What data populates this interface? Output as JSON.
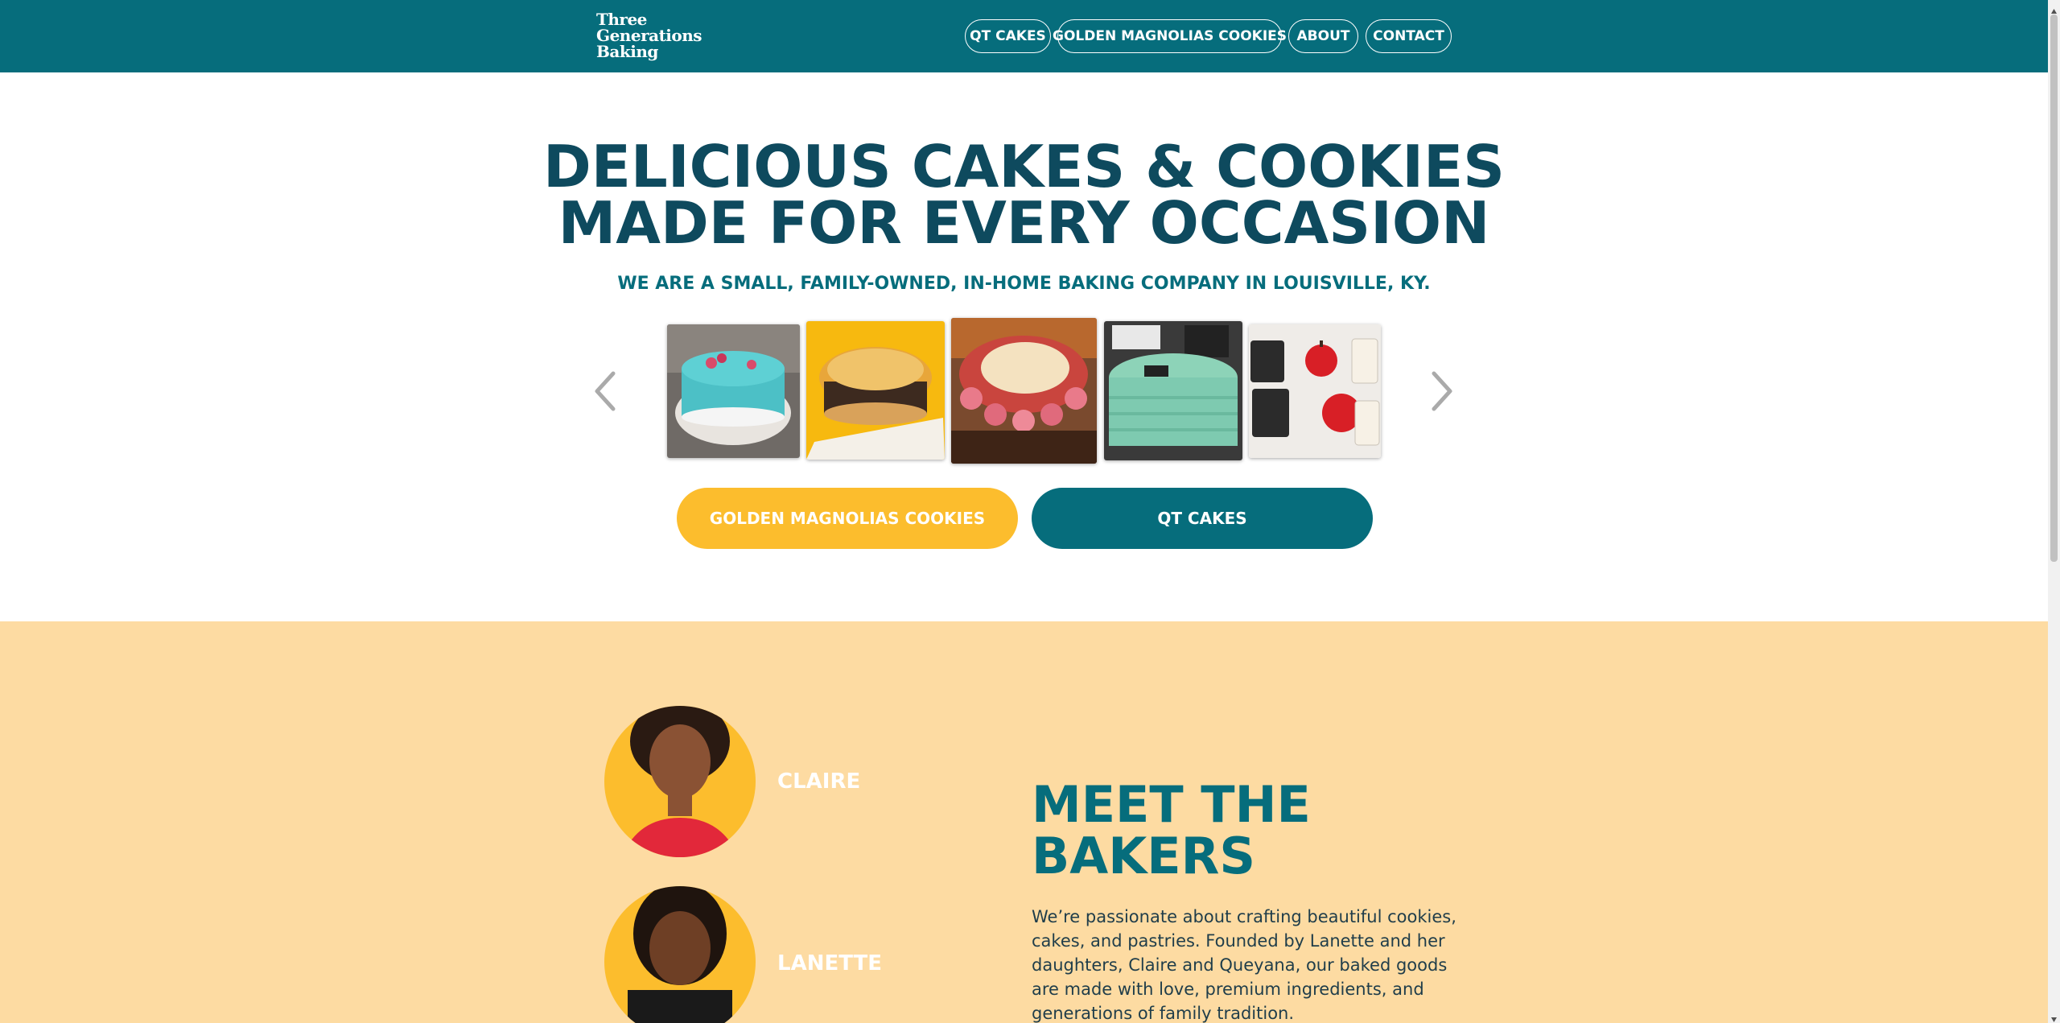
{
  "header": {
    "logo_lines": [
      "Three",
      "Generations",
      "Baking"
    ],
    "nav": [
      {
        "label": "QT CAKES"
      },
      {
        "label": "GOLDEN MAGNOLIAS COOKIES"
      },
      {
        "label": "ABOUT"
      },
      {
        "label": "CONTACT"
      }
    ]
  },
  "hero": {
    "title_lines": [
      "DELICIOUS CAKES & COOKIES",
      "MADE FOR EVERY OCCASION"
    ],
    "subtitle": "WE ARE A SMALL, FAMILY-OWNED, IN-HOME BAKING COMPANY IN LOUISVILLE, KY.",
    "carousel": {
      "prev_icon": "chevron-left-icon",
      "next_icon": "chevron-right-icon",
      "images": [
        "blue-cake-photo",
        "golden-loaf-cake-photo",
        "birthday-susan-cake-photo",
        "makeup-birthday-cake-photo",
        "back-to-school-cookies-photo"
      ]
    },
    "buttons": {
      "gold_label": "GOLDEN MAGNOLIAS COOKIES",
      "teal_label": "QT CAKES"
    }
  },
  "bakers": {
    "people": [
      {
        "name": "CLAIRE"
      },
      {
        "name": "LANETTE"
      }
    ],
    "title_lines": [
      "MEET THE",
      "BAKERS"
    ],
    "paragraph": "We’re passionate about crafting beautiful cookies, cakes, and pastries. Founded by Lanette and her daughters, Claire and Queyana, our baked goods are made with love, premium ingredients, and generations of family tradition."
  },
  "colors": {
    "header_bg": "#066d7c",
    "title": "#0e4a5e",
    "gold": "#fcbd2d",
    "section_bg": "#fddba2"
  }
}
